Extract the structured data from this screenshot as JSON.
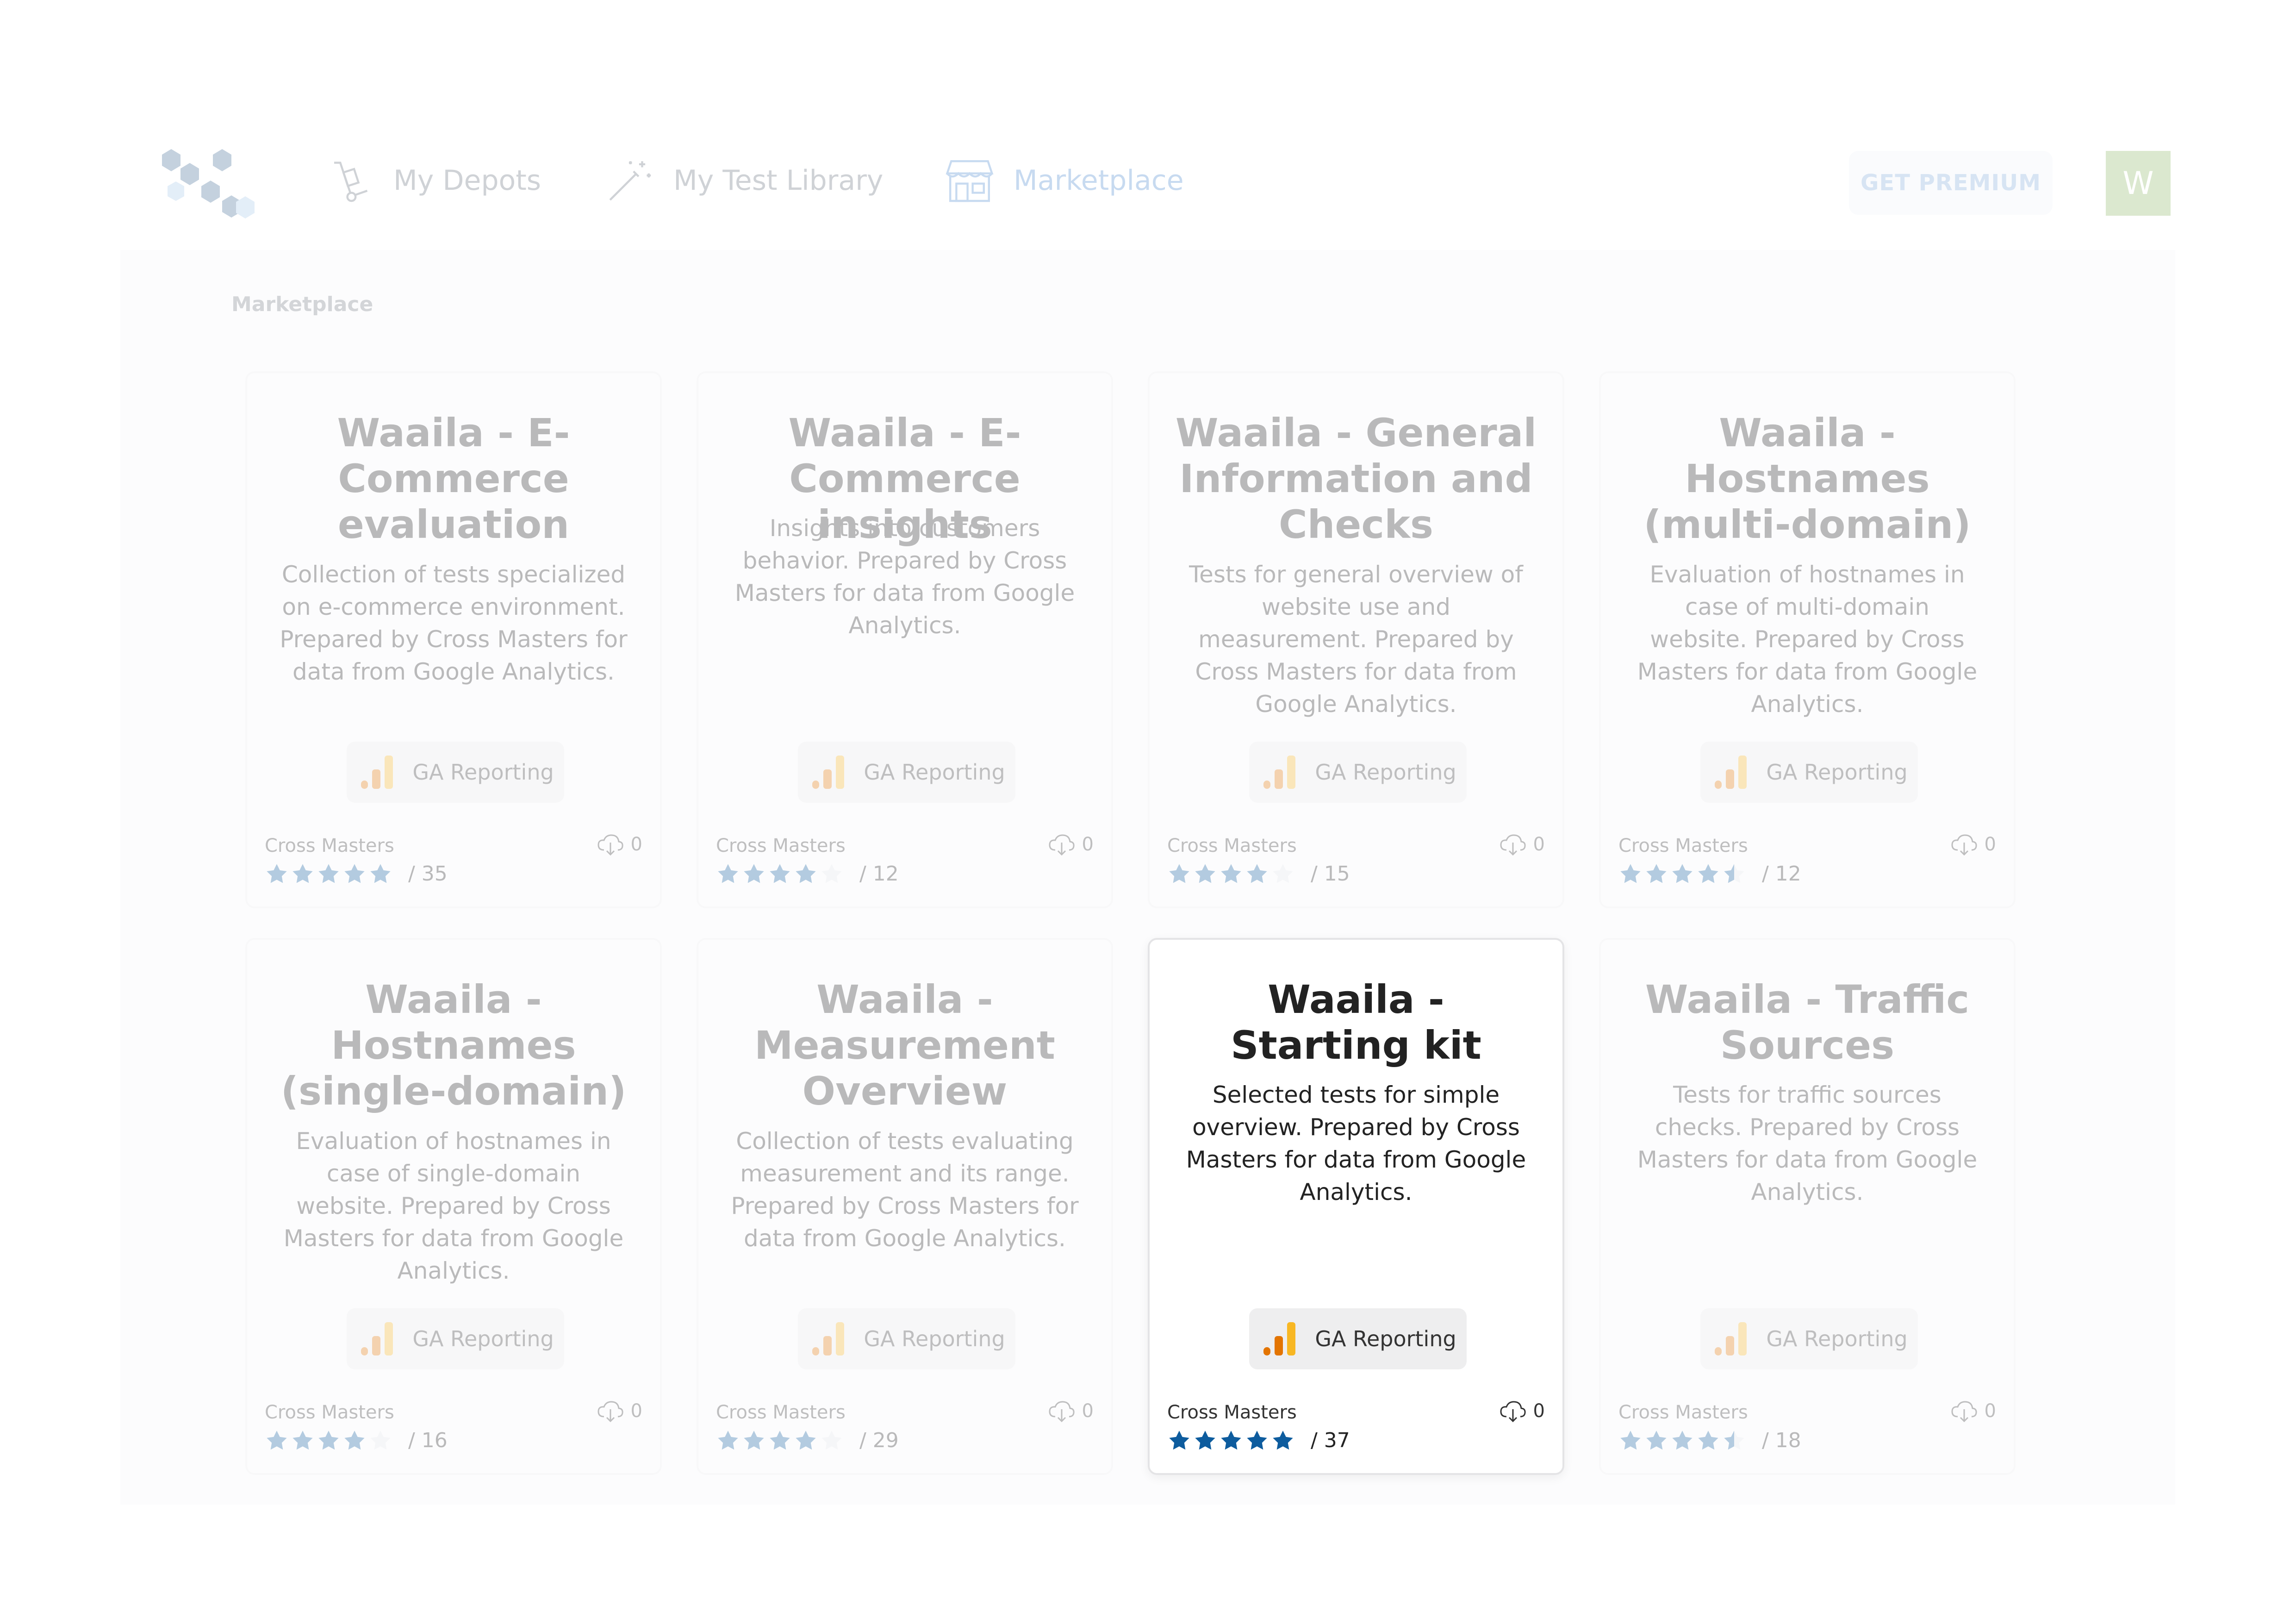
{
  "nav": {
    "items": [
      {
        "label": "My Depots",
        "icon": "hand-truck-icon"
      },
      {
        "label": "My Test Library",
        "icon": "magic-wand-icon"
      },
      {
        "label": "Marketplace",
        "icon": "storefront-icon"
      }
    ],
    "premium_label": "GET PREMIUM",
    "avatar_initial": "W"
  },
  "breadcrumb": "Marketplace",
  "cards": [
    {
      "title": "Waaila - E-Commerce evaluation",
      "description": "Collection of tests specialized on e-commerce environment. Prepared by Cross Masters for data from Google Analytics.",
      "source": "GA Reporting",
      "publisher": "Cross Masters",
      "downloads": "0",
      "rating": 5,
      "rating_count": "/ 35"
    },
    {
      "title": "Waaila - E-Commerce insights",
      "description": "Insights into customers behavior. Prepared by Cross Masters for data from Google Analytics.",
      "source": "GA Reporting",
      "publisher": "Cross Masters",
      "downloads": "0",
      "rating": 4,
      "rating_count": "/ 12"
    },
    {
      "title": "Waaila - General Information and Checks",
      "description": "Tests for general overview of website use and measurement. Prepared by Cross Masters for data from Google Analytics.",
      "source": "GA Reporting",
      "publisher": "Cross Masters",
      "downloads": "0",
      "rating": 4,
      "rating_count": "/ 15"
    },
    {
      "title": "Waaila - Hostnames (multi-domain)",
      "description": "Evaluation of hostnames in case of multi-domain website. Prepared by Cross Masters for data from Google Analytics.",
      "source": "GA Reporting",
      "publisher": "Cross Masters",
      "downloads": "0",
      "rating": 4.5,
      "rating_count": "/ 12"
    },
    {
      "title": "Waaila - Hostnames (single-domain)",
      "description": "Evaluation of hostnames in case of single-domain website. Prepared by Cross Masters for data from Google Analytics.",
      "source": "GA Reporting",
      "publisher": "Cross Masters",
      "downloads": "0",
      "rating": 4,
      "rating_count": "/ 16"
    },
    {
      "title": "Waaila - Measurement Overview",
      "description": "Collection of tests evaluating measurement and its range. Prepared by Cross Masters for data from Google Analytics.",
      "source": "GA Reporting",
      "publisher": "Cross Masters",
      "downloads": "0",
      "rating": 4,
      "rating_count": "/ 29"
    },
    {
      "title": "Waaila - Starting kit",
      "description": "Selected tests for simple overview. Prepared by Cross Masters for data from Google Analytics.",
      "source": "GA Reporting",
      "publisher": "Cross Masters",
      "downloads": "0",
      "rating": 5,
      "rating_count": "/ 37"
    },
    {
      "title": "Waaila - Traffic Sources",
      "description": "Tests for traffic sources checks. Prepared by Cross Masters for data from Google Analytics.",
      "source": "GA Reporting",
      "publisher": "Cross Masters",
      "downloads": "0",
      "rating": 4.5,
      "rating_count": "/ 18"
    }
  ],
  "colors": {
    "star_filled": "#0d5c9e",
    "star_empty": "#e6e9ee",
    "ga_bar_light": "#f8b723",
    "ga_bar_dark": "#e37400"
  },
  "icons": {
    "source": "google-analytics-icon",
    "downloads": "cloud-download-icon",
    "star": "star-icon"
  }
}
